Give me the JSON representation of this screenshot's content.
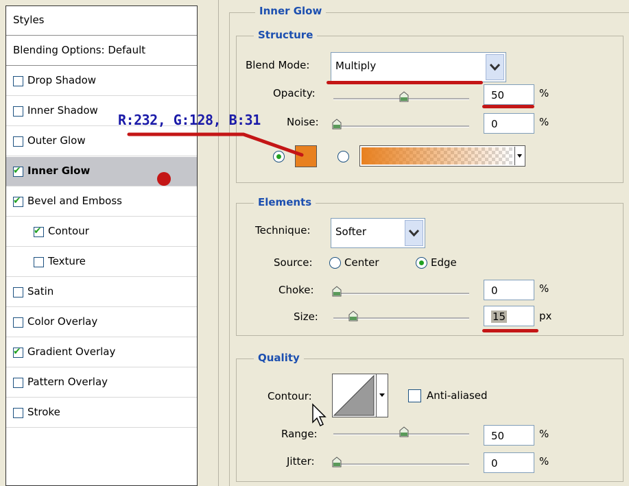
{
  "sidebar": {
    "items": [
      {
        "label": "Styles",
        "checkbox": false,
        "checked": false,
        "indent": false,
        "header": true
      },
      {
        "label": "Blending Options: Default",
        "checkbox": false,
        "checked": false,
        "indent": false,
        "header": true
      },
      {
        "label": "Drop Shadow",
        "checkbox": true,
        "checked": false,
        "indent": false
      },
      {
        "label": "Inner Shadow",
        "checkbox": true,
        "checked": false,
        "indent": false
      },
      {
        "label": "Outer Glow",
        "checkbox": true,
        "checked": false,
        "indent": false
      },
      {
        "label": "Inner Glow",
        "checkbox": true,
        "checked": true,
        "indent": false,
        "selected": true
      },
      {
        "label": "Bevel and Emboss",
        "checkbox": true,
        "checked": true,
        "indent": false
      },
      {
        "label": "Contour",
        "checkbox": true,
        "checked": true,
        "indent": true
      },
      {
        "label": "Texture",
        "checkbox": true,
        "checked": false,
        "indent": true
      },
      {
        "label": "Satin",
        "checkbox": true,
        "checked": false,
        "indent": false
      },
      {
        "label": "Color Overlay",
        "checkbox": true,
        "checked": false,
        "indent": false
      },
      {
        "label": "Gradient Overlay",
        "checkbox": true,
        "checked": true,
        "indent": false
      },
      {
        "label": "Pattern Overlay",
        "checkbox": true,
        "checked": false,
        "indent": false
      },
      {
        "label": "Stroke",
        "checkbox": true,
        "checked": false,
        "indent": false
      }
    ]
  },
  "panel": {
    "title": "Inner Glow",
    "structure": {
      "title": "Structure",
      "blend_mode_label": "Blend Mode:",
      "blend_mode_value": "Multiply",
      "opacity_label": "Opacity:",
      "opacity_value": "50",
      "opacity_unit": "%",
      "opacity_fraction": 0.5,
      "noise_label": "Noise:",
      "noise_value": "0",
      "noise_unit": "%",
      "noise_fraction": 0.0,
      "glow_color": "#e8801f",
      "color_radio_selected": true,
      "gradient_radio_selected": false
    },
    "elements": {
      "title": "Elements",
      "technique_label": "Technique:",
      "technique_value": "Softer",
      "source_label": "Source:",
      "source_center": "Center",
      "source_edge": "Edge",
      "source_selected": "Edge",
      "choke_label": "Choke:",
      "choke_value": "0",
      "choke_unit": "%",
      "choke_fraction": 0.0,
      "size_label": "Size:",
      "size_value": "15",
      "size_unit": "px",
      "size_fraction": 0.06
    },
    "quality": {
      "title": "Quality",
      "contour_label": "Contour:",
      "anti_aliased_label": "Anti-aliased",
      "anti_aliased_checked": false,
      "range_label": "Range:",
      "range_value": "50",
      "range_unit": "%",
      "range_fraction": 0.5,
      "jitter_label": "Jitter:",
      "jitter_value": "0",
      "jitter_unit": "%",
      "jitter_fraction": 0.0
    }
  },
  "annotation": {
    "text": "R:232, G:128, B:31",
    "color": "#1a1aa8",
    "marker_color": "#c41616"
  }
}
